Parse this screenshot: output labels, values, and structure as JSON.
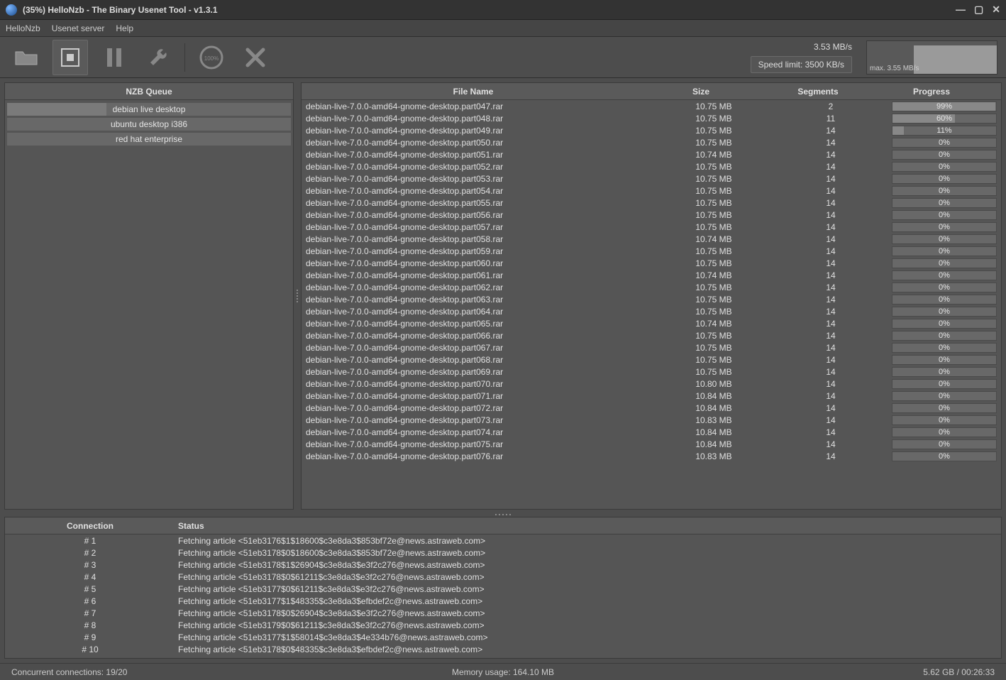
{
  "window": {
    "title": "(35%) HelloNzb - The Binary Usenet Tool - v1.3.1"
  },
  "menu": {
    "items": [
      "HelloNzb",
      "Usenet server",
      "Help"
    ]
  },
  "toolbar": {
    "speed_text": "3.53 MB/s",
    "speed_limit_label": "Speed limit: 3500 KB/s",
    "graph_max": "max. 3.55 MB/s"
  },
  "queue": {
    "header": "NZB Queue",
    "items": [
      {
        "label": "debian live desktop",
        "progress": 35
      },
      {
        "label": "ubuntu desktop i386",
        "progress": 0
      },
      {
        "label": "red hat enterprise",
        "progress": 0
      }
    ]
  },
  "files": {
    "headers": {
      "name": "File Name",
      "size": "Size",
      "segments": "Segments",
      "progress": "Progress"
    },
    "rows": [
      {
        "name": "debian-live-7.0.0-amd64-gnome-desktop.part047.rar",
        "size": "10.75 MB",
        "segments": "2",
        "progress": 99
      },
      {
        "name": "debian-live-7.0.0-amd64-gnome-desktop.part048.rar",
        "size": "10.75 MB",
        "segments": "11",
        "progress": 60
      },
      {
        "name": "debian-live-7.0.0-amd64-gnome-desktop.part049.rar",
        "size": "10.75 MB",
        "segments": "14",
        "progress": 11
      },
      {
        "name": "debian-live-7.0.0-amd64-gnome-desktop.part050.rar",
        "size": "10.75 MB",
        "segments": "14",
        "progress": 0
      },
      {
        "name": "debian-live-7.0.0-amd64-gnome-desktop.part051.rar",
        "size": "10.74 MB",
        "segments": "14",
        "progress": 0
      },
      {
        "name": "debian-live-7.0.0-amd64-gnome-desktop.part052.rar",
        "size": "10.75 MB",
        "segments": "14",
        "progress": 0
      },
      {
        "name": "debian-live-7.0.0-amd64-gnome-desktop.part053.rar",
        "size": "10.75 MB",
        "segments": "14",
        "progress": 0
      },
      {
        "name": "debian-live-7.0.0-amd64-gnome-desktop.part054.rar",
        "size": "10.75 MB",
        "segments": "14",
        "progress": 0
      },
      {
        "name": "debian-live-7.0.0-amd64-gnome-desktop.part055.rar",
        "size": "10.75 MB",
        "segments": "14",
        "progress": 0
      },
      {
        "name": "debian-live-7.0.0-amd64-gnome-desktop.part056.rar",
        "size": "10.75 MB",
        "segments": "14",
        "progress": 0
      },
      {
        "name": "debian-live-7.0.0-amd64-gnome-desktop.part057.rar",
        "size": "10.75 MB",
        "segments": "14",
        "progress": 0
      },
      {
        "name": "debian-live-7.0.0-amd64-gnome-desktop.part058.rar",
        "size": "10.74 MB",
        "segments": "14",
        "progress": 0
      },
      {
        "name": "debian-live-7.0.0-amd64-gnome-desktop.part059.rar",
        "size": "10.75 MB",
        "segments": "14",
        "progress": 0
      },
      {
        "name": "debian-live-7.0.0-amd64-gnome-desktop.part060.rar",
        "size": "10.75 MB",
        "segments": "14",
        "progress": 0
      },
      {
        "name": "debian-live-7.0.0-amd64-gnome-desktop.part061.rar",
        "size": "10.74 MB",
        "segments": "14",
        "progress": 0
      },
      {
        "name": "debian-live-7.0.0-amd64-gnome-desktop.part062.rar",
        "size": "10.75 MB",
        "segments": "14",
        "progress": 0
      },
      {
        "name": "debian-live-7.0.0-amd64-gnome-desktop.part063.rar",
        "size": "10.75 MB",
        "segments": "14",
        "progress": 0
      },
      {
        "name": "debian-live-7.0.0-amd64-gnome-desktop.part064.rar",
        "size": "10.75 MB",
        "segments": "14",
        "progress": 0
      },
      {
        "name": "debian-live-7.0.0-amd64-gnome-desktop.part065.rar",
        "size": "10.74 MB",
        "segments": "14",
        "progress": 0
      },
      {
        "name": "debian-live-7.0.0-amd64-gnome-desktop.part066.rar",
        "size": "10.75 MB",
        "segments": "14",
        "progress": 0
      },
      {
        "name": "debian-live-7.0.0-amd64-gnome-desktop.part067.rar",
        "size": "10.75 MB",
        "segments": "14",
        "progress": 0
      },
      {
        "name": "debian-live-7.0.0-amd64-gnome-desktop.part068.rar",
        "size": "10.75 MB",
        "segments": "14",
        "progress": 0
      },
      {
        "name": "debian-live-7.0.0-amd64-gnome-desktop.part069.rar",
        "size": "10.75 MB",
        "segments": "14",
        "progress": 0
      },
      {
        "name": "debian-live-7.0.0-amd64-gnome-desktop.part070.rar",
        "size": "10.80 MB",
        "segments": "14",
        "progress": 0
      },
      {
        "name": "debian-live-7.0.0-amd64-gnome-desktop.part071.rar",
        "size": "10.84 MB",
        "segments": "14",
        "progress": 0
      },
      {
        "name": "debian-live-7.0.0-amd64-gnome-desktop.part072.rar",
        "size": "10.84 MB",
        "segments": "14",
        "progress": 0
      },
      {
        "name": "debian-live-7.0.0-amd64-gnome-desktop.part073.rar",
        "size": "10.83 MB",
        "segments": "14",
        "progress": 0
      },
      {
        "name": "debian-live-7.0.0-amd64-gnome-desktop.part074.rar",
        "size": "10.84 MB",
        "segments": "14",
        "progress": 0
      },
      {
        "name": "debian-live-7.0.0-amd64-gnome-desktop.part075.rar",
        "size": "10.84 MB",
        "segments": "14",
        "progress": 0
      },
      {
        "name": "debian-live-7.0.0-amd64-gnome-desktop.part076.rar",
        "size": "10.83 MB",
        "segments": "14",
        "progress": 0
      }
    ]
  },
  "connections": {
    "headers": {
      "id": "Connection",
      "status": "Status"
    },
    "rows": [
      {
        "id": "# 1",
        "status": "Fetching article <51eb3176$1$18600$c3e8da3$853bf72e@news.astraweb.com>"
      },
      {
        "id": "# 2",
        "status": "Fetching article <51eb3178$0$18600$c3e8da3$853bf72e@news.astraweb.com>"
      },
      {
        "id": "# 3",
        "status": "Fetching article <51eb3178$1$26904$c3e8da3$e3f2c276@news.astraweb.com>"
      },
      {
        "id": "# 4",
        "status": "Fetching article <51eb3178$0$61211$c3e8da3$e3f2c276@news.astraweb.com>"
      },
      {
        "id": "# 5",
        "status": "Fetching article <51eb3177$0$61211$c3e8da3$e3f2c276@news.astraweb.com>"
      },
      {
        "id": "# 6",
        "status": "Fetching article <51eb3177$1$48335$c3e8da3$efbdef2c@news.astraweb.com>"
      },
      {
        "id": "# 7",
        "status": "Fetching article <51eb3178$0$26904$c3e8da3$e3f2c276@news.astraweb.com>"
      },
      {
        "id": "# 8",
        "status": "Fetching article <51eb3179$0$61211$c3e8da3$e3f2c276@news.astraweb.com>"
      },
      {
        "id": "# 9",
        "status": "Fetching article <51eb3177$1$58014$c3e8da3$4e334b76@news.astraweb.com>"
      },
      {
        "id": "# 10",
        "status": "Fetching article <51eb3178$0$48335$c3e8da3$efbdef2c@news.astraweb.com>"
      }
    ]
  },
  "status": {
    "connections": "Concurrent connections: 19/20",
    "memory": "Memory usage: 164.10 MB",
    "totals": "5.62 GB / 00:26:33"
  }
}
